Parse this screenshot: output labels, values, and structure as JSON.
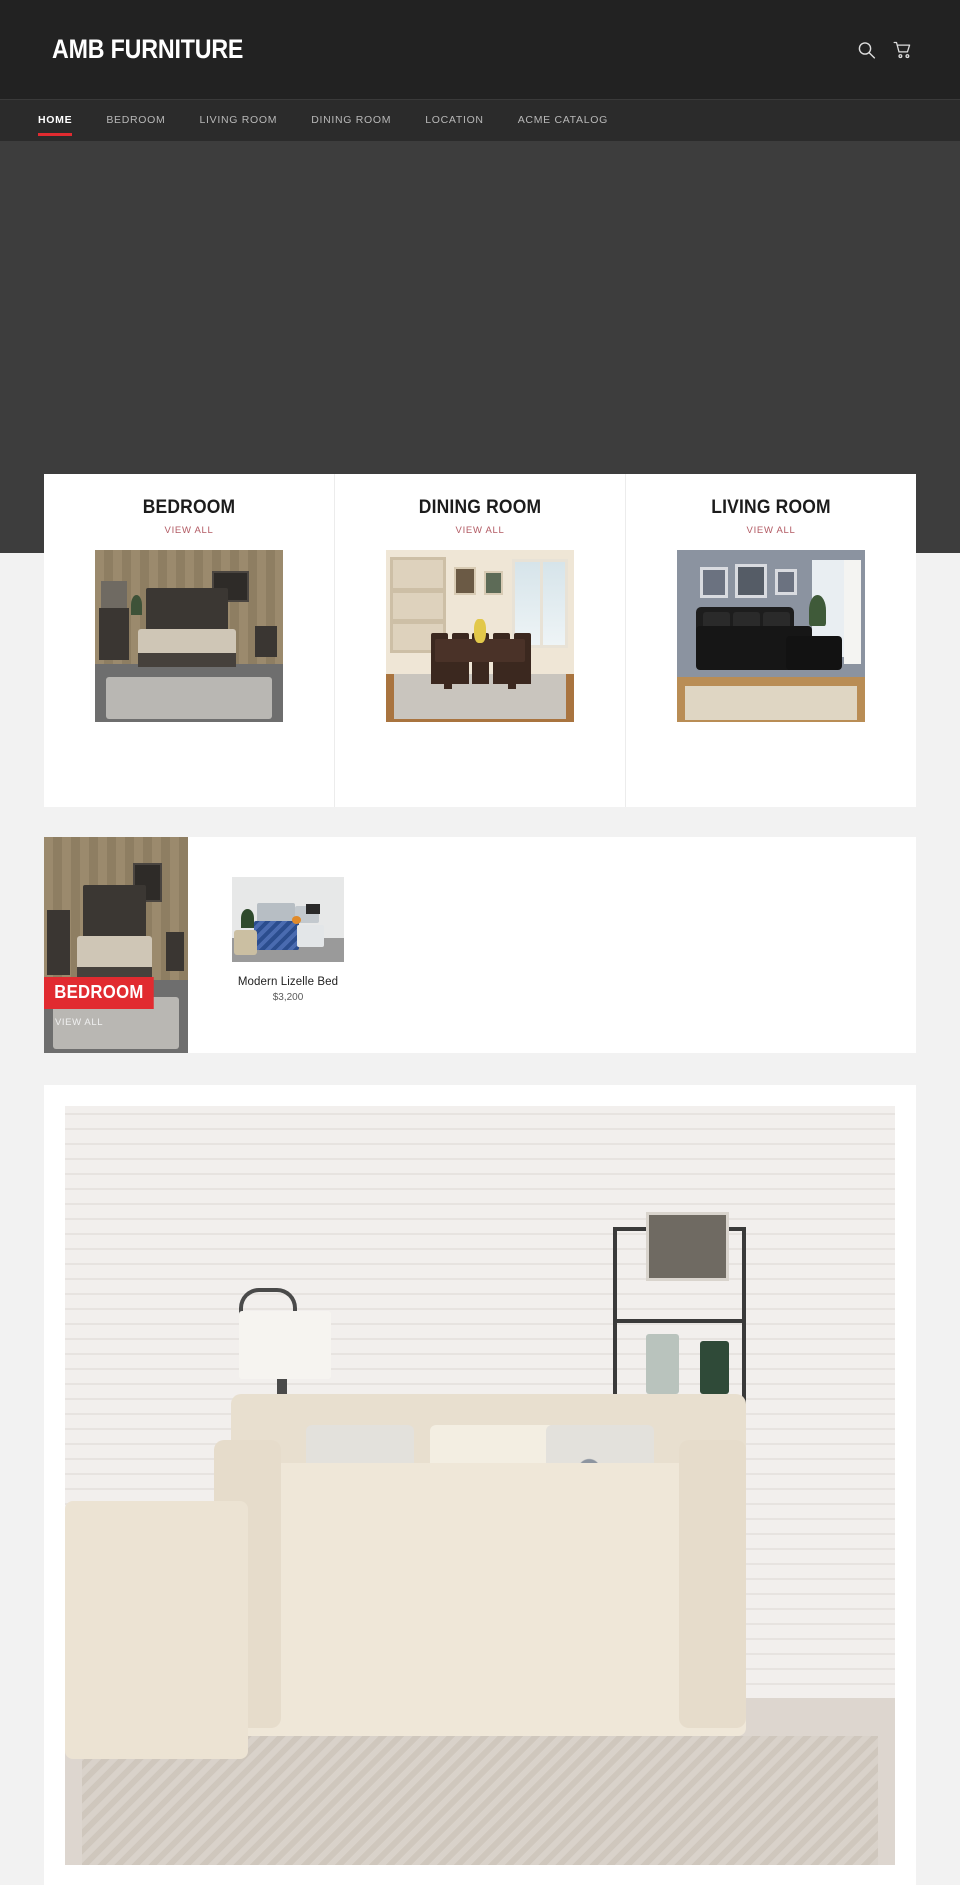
{
  "theme": {
    "accent": "#e12b30",
    "header_bg": "#222222",
    "nav_bg": "#2b2b2b",
    "page_bg": "#f2f2f2",
    "viewall_color": "#b25a63"
  },
  "header": {
    "brand": "AMB FURNITURE",
    "search_icon": "search-icon",
    "cart_icon": "cart-icon"
  },
  "nav": {
    "items": [
      {
        "label": "HOME",
        "active": true
      },
      {
        "label": "BEDROOM",
        "active": false
      },
      {
        "label": "LIVING ROOM",
        "active": false
      },
      {
        "label": "DINING ROOM",
        "active": false
      },
      {
        "label": "LOCATION",
        "active": false
      },
      {
        "label": "ACME CATALOG",
        "active": false
      }
    ]
  },
  "categories": [
    {
      "title": "BEDROOM",
      "view_all": "VIEW ALL"
    },
    {
      "title": "DINING ROOM",
      "view_all": "VIEW ALL"
    },
    {
      "title": "LIVING ROOM",
      "view_all": "VIEW ALL"
    }
  ],
  "featured": {
    "banner": {
      "badge": "BEDROOM",
      "view_all": "VIEW ALL"
    },
    "products": [
      {
        "title": "Modern Lizelle Bed",
        "price": "$3,200"
      }
    ]
  },
  "bottom_banner": {
    "alt": "living-room-sofa-banner"
  }
}
